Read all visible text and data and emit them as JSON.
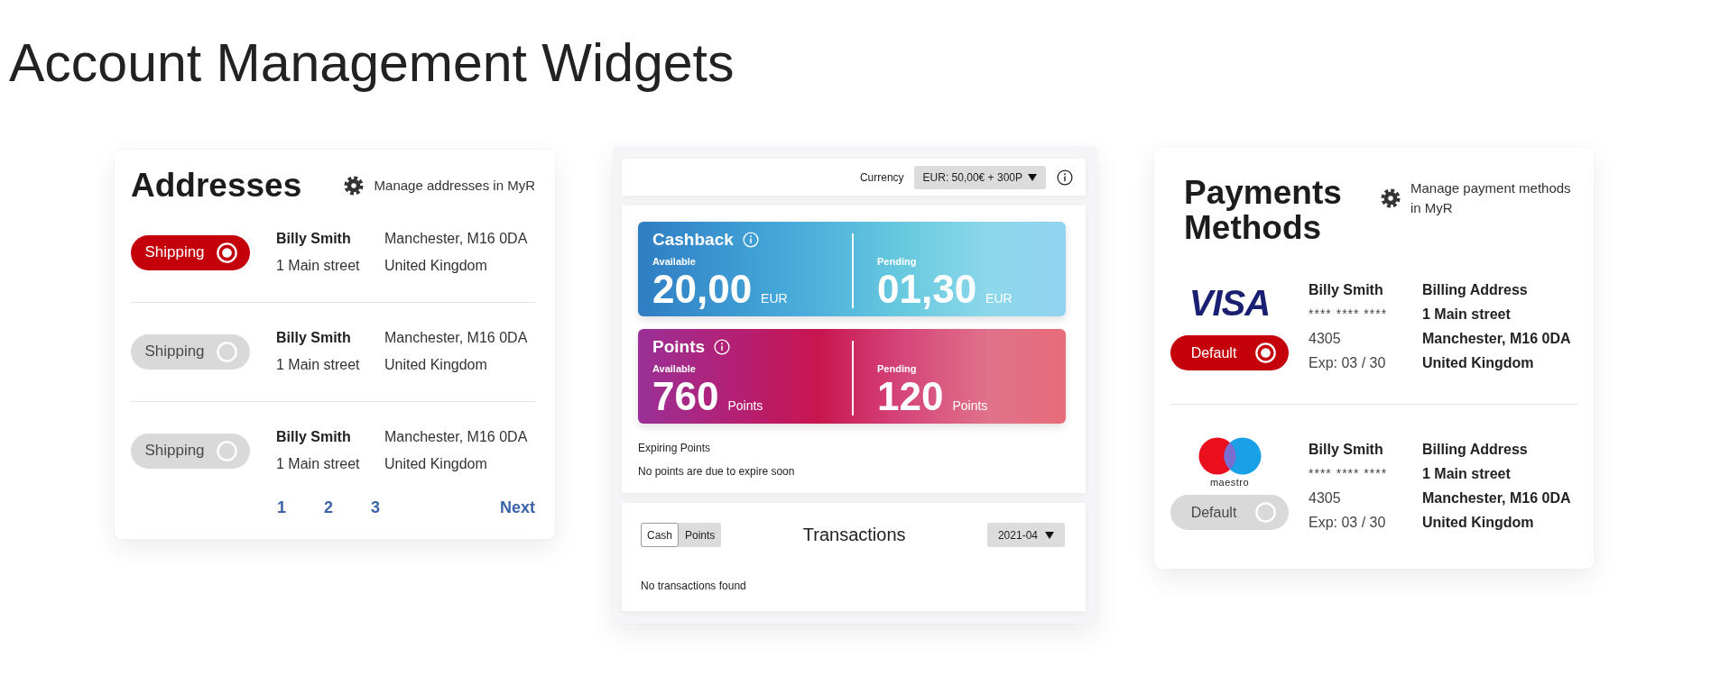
{
  "page_title": "Account Management Widgets",
  "addresses": {
    "title": "Addresses",
    "manage_link": "Manage addresses in MyR",
    "items": [
      {
        "toggle_label": "Shipping",
        "selected": true,
        "name": "Billy Smith",
        "street": "1 Main street",
        "city": "Manchester, M16 0DA",
        "country": "United Kingdom"
      },
      {
        "toggle_label": "Shipping",
        "selected": false,
        "name": "Billy Smith",
        "street": "1 Main street",
        "city": "Manchester, M16 0DA",
        "country": "United Kingdom"
      },
      {
        "toggle_label": "Shipping",
        "selected": false,
        "name": "Billy Smith",
        "street": "1 Main street",
        "city": "Manchester, M16 0DA",
        "country": "United Kingdom"
      }
    ],
    "pagination": {
      "pages": [
        "1",
        "2",
        "3"
      ],
      "next": "Next"
    }
  },
  "wallet": {
    "currency_label": "Currency",
    "currency_value": "EUR: 50,00€ + 300P",
    "tiles": [
      {
        "kind": "cashback",
        "title": "Cashback",
        "available_label": "Available",
        "available_amount": "20,00",
        "available_unit": "EUR",
        "pending_label": "Pending",
        "pending_amount": "01,30",
        "pending_unit": "EUR"
      },
      {
        "kind": "points",
        "title": "Points",
        "available_label": "Available",
        "available_amount": "760",
        "available_unit": "Points",
        "pending_label": "Pending",
        "pending_amount": "120",
        "pending_unit": "Points"
      }
    ],
    "expiring_title": "Expiring Points",
    "expiring_text": "No points are due to expire soon"
  },
  "transactions": {
    "tabs": [
      {
        "label": "Cash",
        "selected": true
      },
      {
        "label": "Points",
        "selected": false
      }
    ],
    "title": "Transactions",
    "month": "2021-04",
    "empty_text": "No transactions found"
  },
  "payments": {
    "title": "Payments Methods",
    "manage_link": "Manage payment methods in MyR",
    "methods": [
      {
        "kind": "visa",
        "brand": "VISA",
        "toggle_label": "Default",
        "selected": true,
        "holder": "Billy Smith",
        "masked_number": "**** **** ****",
        "last_digits": "4305",
        "expiry": "Exp: 03 / 30",
        "billing_title": "Billing Address",
        "billing_lines": [
          "1 Main street",
          "Manchester, M16 0DA",
          "United Kingdom"
        ]
      },
      {
        "kind": "maestro",
        "brand": "maestro",
        "toggle_label": "Default",
        "selected": false,
        "holder": "Billy Smith",
        "masked_number": "**** **** ****",
        "last_digits": "4305",
        "expiry": "Exp: 03 / 30",
        "billing_title": "Billing Address",
        "billing_lines": [
          "1 Main street",
          "Manchester, M16 0DA",
          "United Kingdom"
        ]
      }
    ]
  }
}
